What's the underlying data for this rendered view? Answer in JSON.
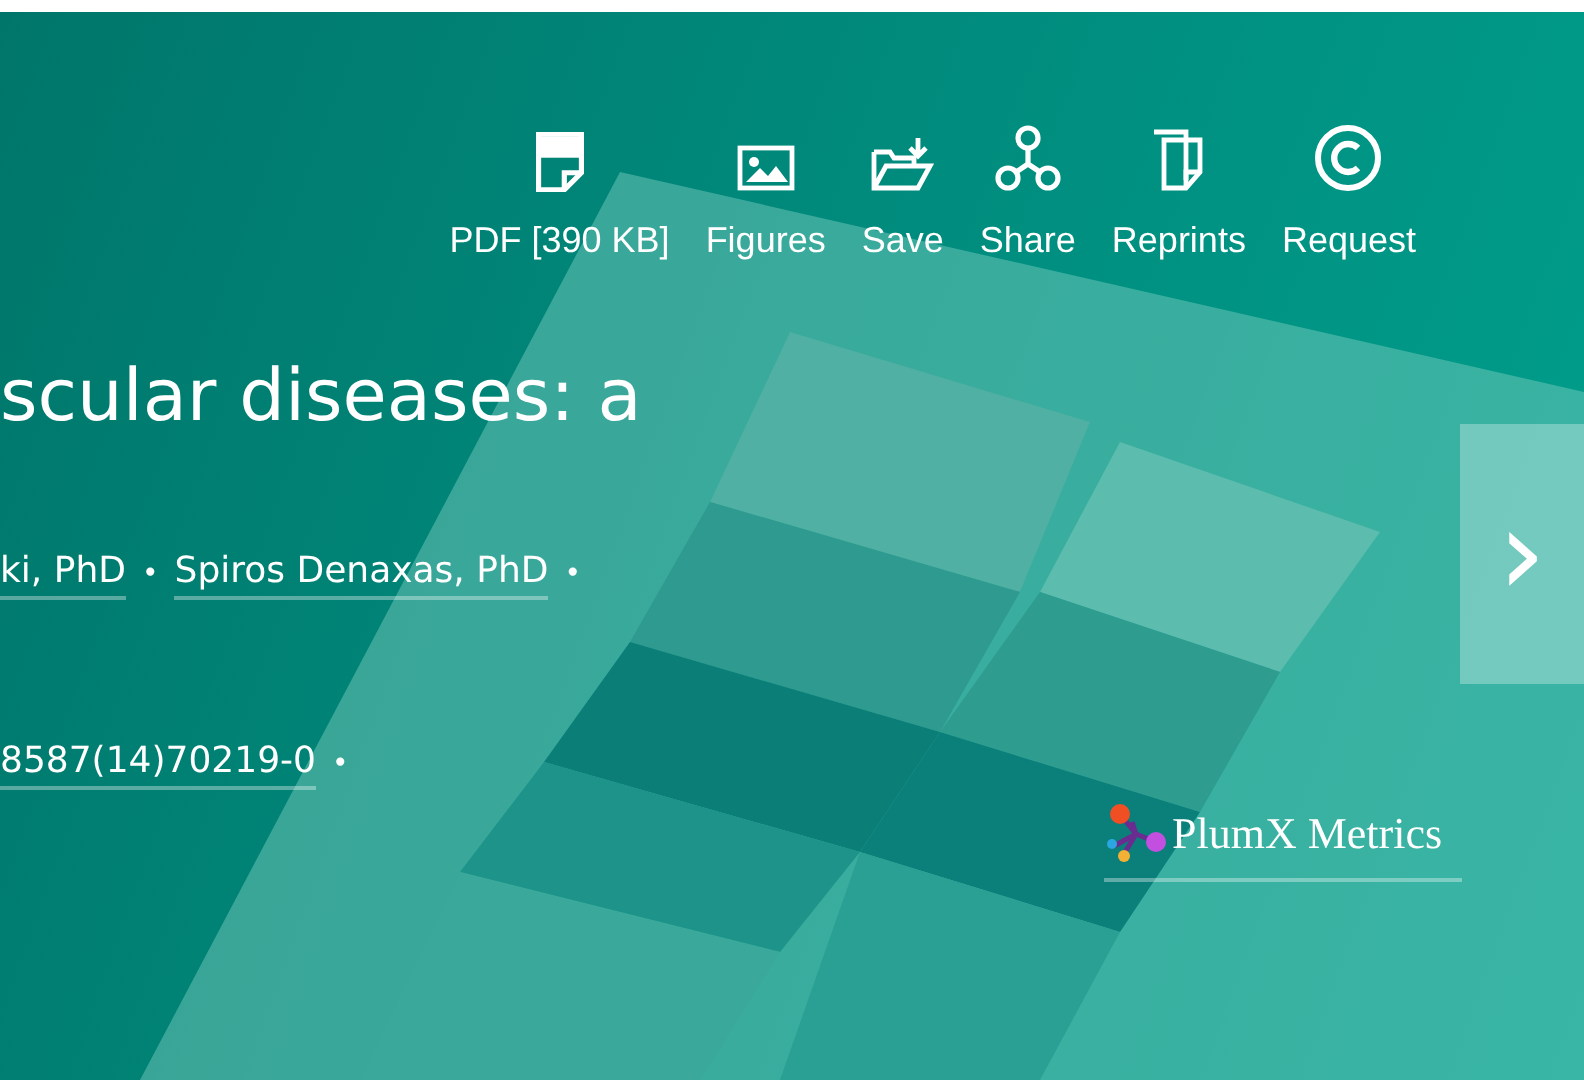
{
  "toolbar": [
    {
      "label": "PDF [390 KB]"
    },
    {
      "label": "Figures"
    },
    {
      "label": "Save"
    },
    {
      "label": "Share"
    },
    {
      "label": "Reprints"
    },
    {
      "label": "Request"
    }
  ],
  "title": "scular diseases: a",
  "authors": [
    {
      "name": "ki, PhD",
      "after": "•"
    },
    {
      "name": "Spiros Denaxas, PhD",
      "after": "•"
    }
  ],
  "doi": {
    "text": "8587(14)70219-0",
    "after": "•"
  },
  "metrics": {
    "label": "PlumX Metrics"
  },
  "next_button": {
    "label": "›"
  }
}
